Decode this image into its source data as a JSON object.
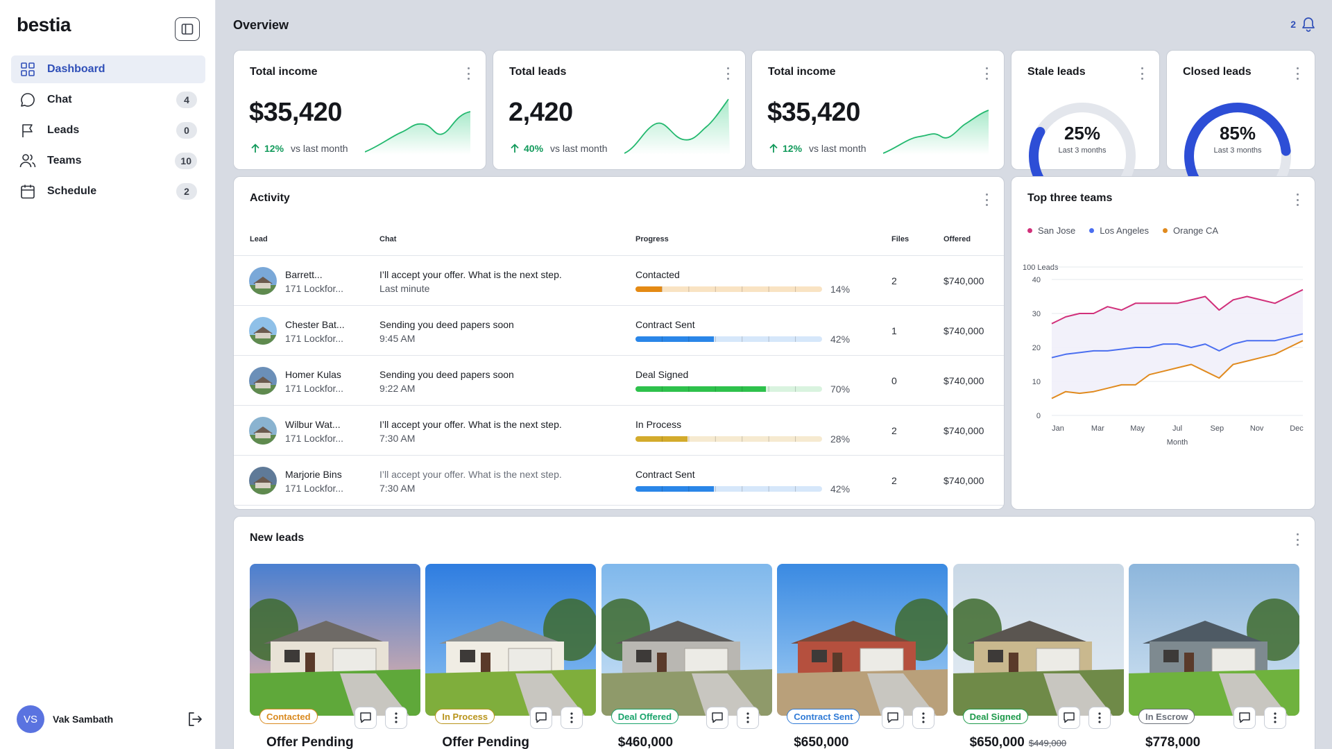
{
  "app": {
    "logo": "bestia"
  },
  "sidebar": {
    "items": [
      {
        "label": "Dashboard",
        "icon": "grid-icon",
        "count": ""
      },
      {
        "label": "Chat",
        "icon": "chat-icon",
        "count": "4"
      },
      {
        "label": "Leads",
        "icon": "flag-icon",
        "count": "0"
      },
      {
        "label": "Teams",
        "icon": "people-icon",
        "count": "10"
      },
      {
        "label": "Schedule",
        "icon": "calendar-icon",
        "count": "2"
      }
    ],
    "user": {
      "initials": "VS",
      "name": "Vak Sambath"
    }
  },
  "header": {
    "title": "Overview",
    "notifications": "2"
  },
  "stats": [
    {
      "title": "Total income",
      "value": "$35,420",
      "delta": "12%",
      "delta_label": "vs last month"
    },
    {
      "title": "Total leads",
      "value": "2,420",
      "delta": "40%",
      "delta_label": "vs last month"
    },
    {
      "title": "Total income",
      "value": "$35,420",
      "delta": "12%",
      "delta_label": "vs last month"
    }
  ],
  "gauges": [
    {
      "title": "Stale leads",
      "value": "25%",
      "fraction": 0.25,
      "sub": "Last 3 months"
    },
    {
      "title": "Closed leads",
      "value": "85%",
      "fraction": 0.85,
      "sub": "Last 3 months"
    }
  ],
  "activity": {
    "title": "Activity",
    "columns": {
      "lead": "Lead",
      "chat": "Chat",
      "progress": "Progress",
      "files": "Files",
      "offered": "Offered"
    },
    "rows": [
      {
        "name": "Barrett...",
        "address": "171 Lockfor...",
        "message": "I’ll accept your offer. What is the next step.",
        "time": "Last minute",
        "status": "Contacted",
        "progress": "14%",
        "fraction": 0.14,
        "files": "2",
        "offered": "$740,000"
      },
      {
        "name": "Chester Bat...",
        "address": "171 Lockfor...",
        "message": "Sending you deed papers soon",
        "time": "9:45 AM",
        "status": "Contract Sent",
        "progress": "42%",
        "fraction": 0.42,
        "files": "1",
        "offered": "$740,000"
      },
      {
        "name": "Homer Kulas",
        "address": "171 Lockfor...",
        "message": "Sending you deed papers soon",
        "time": "9:22 AM",
        "status": "Deal Signed",
        "progress": "70%",
        "fraction": 0.7,
        "files": "0",
        "offered": "$740,000"
      },
      {
        "name": "Wilbur Wat...",
        "address": "171 Lockfor...",
        "message": "I’ll accept your offer. What is the next step.",
        "time": "7:30 AM",
        "status": "In Process",
        "progress": "28%",
        "fraction": 0.28,
        "files": "2",
        "offered": "$740,000"
      },
      {
        "name": "Marjorie Bins",
        "address": "171 Lockfor...",
        "message": "I’ll accept your offer. What is the next step.",
        "time": "7:30 AM",
        "status": "Contract Sent",
        "progress": "42%",
        "fraction": 0.42,
        "files": "2",
        "offered": "$740,000"
      }
    ]
  },
  "top_teams": {
    "title": "Top three teams"
  },
  "chart_data": {
    "type": "line",
    "title": "",
    "xlabel": "Month",
    "ylabel": "100 Leads",
    "ylim": [
      0,
      40
    ],
    "yticks": [
      "0",
      "10",
      "20",
      "30",
      "40"
    ],
    "categories": [
      "Jan",
      "Mar",
      "May",
      "Jul",
      "Sep",
      "Nov",
      "Dec"
    ],
    "grid": true,
    "legend": "top-left",
    "series": [
      {
        "name": "San Jose",
        "color": "#d1307a",
        "values": [
          27,
          29,
          30,
          30,
          32,
          31,
          33,
          33,
          33,
          33,
          34,
          35,
          31,
          34,
          35,
          34,
          33,
          35,
          37
        ]
      },
      {
        "name": "Los Angeles",
        "color": "#4a6ef0",
        "values": [
          17,
          18,
          18.5,
          19,
          19,
          19.5,
          20,
          20,
          21,
          21,
          20,
          21,
          19,
          21,
          22,
          22,
          22,
          23,
          24
        ]
      },
      {
        "name": "Orange CA",
        "color": "#e08a1e",
        "values": [
          5,
          7,
          6.5,
          7,
          8,
          9,
          9,
          12,
          13,
          14,
          15,
          13,
          11,
          15,
          16,
          17,
          18,
          20,
          22
        ]
      }
    ]
  },
  "new_leads": {
    "title": "New leads",
    "items": [
      {
        "badge": "Contacted",
        "badge_color": "#d9891e",
        "price": "Offer Pending",
        "old_price": ""
      },
      {
        "badge": "In Process",
        "badge_color": "#b8931a",
        "price": "Offer Pending",
        "old_price": ""
      },
      {
        "badge": "Deal Offered",
        "badge_color": "#18a36a",
        "price": "$460,000",
        "old_price": ""
      },
      {
        "badge": "Contract Sent",
        "badge_color": "#2f7ad6",
        "price": "$650,000",
        "old_price": ""
      },
      {
        "badge": "Deal Signed",
        "badge_color": "#1d9a4a",
        "price": "$650,000",
        "old_price": "$449,000"
      },
      {
        "badge": "In Escrow",
        "badge_color": "#6a6f79",
        "price": "$778,000",
        "old_price": ""
      }
    ]
  }
}
